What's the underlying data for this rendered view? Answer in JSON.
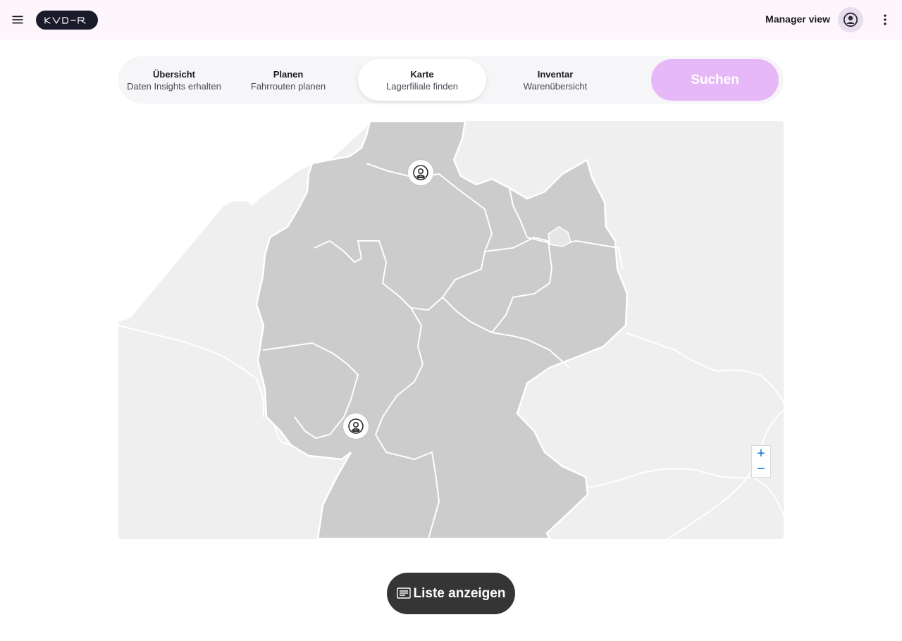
{
  "header": {
    "menu_icon": "hamburger-menu-icon",
    "logo_text": "KVD-R",
    "view_label": "Manager view",
    "avatar_icon": "account-circle-icon",
    "more_icon": "more-vertical-icon"
  },
  "tabs": [
    {
      "title": "Übersicht",
      "subtitle": "Daten Insights erhalten",
      "active": false
    },
    {
      "title": "Planen",
      "subtitle": "Fahrrouten planen",
      "active": false
    },
    {
      "title": "Karte",
      "subtitle": "Lagerfiliale finden",
      "active": true
    },
    {
      "title": "Inventar",
      "subtitle": "Warenübersicht",
      "active": false
    }
  ],
  "search_button": {
    "label": "Suchen",
    "color": "#e6b8f8"
  },
  "map": {
    "pins": [
      {
        "icon": "driver-pin-icon"
      },
      {
        "icon": "driver-pin-icon"
      }
    ],
    "zoom_in": "+",
    "zoom_out": "−"
  },
  "list_button": {
    "label": "Liste anzeigen",
    "icon": "list-icon"
  }
}
